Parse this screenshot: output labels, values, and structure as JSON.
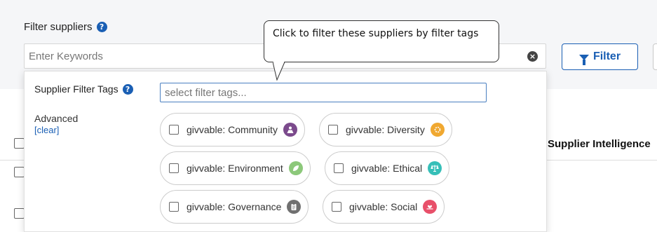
{
  "header": {
    "title": "Filter suppliers",
    "help_glyph": "?"
  },
  "search": {
    "placeholder": "Enter Keywords",
    "clear_glyph": "×"
  },
  "filter_button": {
    "label": "Filter"
  },
  "tooltip": {
    "text": "Click to filter these suppliers by filter tags"
  },
  "table": {
    "column_header": "Supplier Intelligence"
  },
  "dropdown": {
    "tags_label": "Supplier Filter Tags",
    "tags_placeholder": "select filter tags...",
    "advanced_label": "Advanced",
    "clear_link": "[clear]",
    "tags": [
      {
        "label": "givvable: Community",
        "icon": "community-icon",
        "color": "#7b4a8c"
      },
      {
        "label": "givvable: Diversity",
        "icon": "diversity-icon",
        "color": "#f0a830"
      },
      {
        "label": "givvable: Environment",
        "icon": "leaf-icon",
        "color": "#8cc87a"
      },
      {
        "label": "givvable: Ethical",
        "icon": "scales-icon",
        "color": "#36bfb8"
      },
      {
        "label": "givvable: Governance",
        "icon": "clipboard-icon",
        "color": "#707070"
      },
      {
        "label": "givvable: Social",
        "icon": "heart-hand-icon",
        "color": "#e8506a"
      }
    ]
  },
  "colors": {
    "accent": "#1a5fb4",
    "band": "#f5f6f8"
  }
}
